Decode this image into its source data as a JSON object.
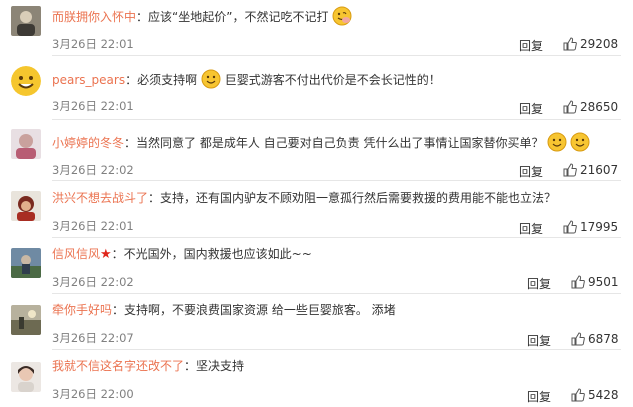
{
  "comments": [
    {
      "username": "而朕拥你入怀中",
      "text": "：应该“坐地起价”，不然记吃不记打",
      "emoji": "face-peek-icon",
      "time": "3月26日 22:01",
      "reply_label": "回复",
      "likes": "29208"
    },
    {
      "username": "pears_pears",
      "text_before": "：必须支持啊",
      "emoji": "smile-face-icon",
      "text_after": "巨婴式游客不付出代价是不会长记性的！",
      "time": "3月26日 22:01",
      "reply_label": "回复",
      "likes": "28650"
    },
    {
      "username": "小婷婷的冬冬",
      "text": "：当然同意了 都是成年人 自己要对自己负责 凭什么出了事情让国家替你买单？",
      "emoji": "double-smile-face-icon",
      "time": "3月26日 22:02",
      "reply_label": "回复",
      "likes": "21607"
    },
    {
      "username": "洪兴不想去战斗了",
      "text": "：支持，还有国内驴友不顾劝阻一意孤行然后需要救援的费用能不能也立法？",
      "time": "3月26日 22:01",
      "reply_label": "回复",
      "likes": "17995"
    },
    {
      "username": "信风信风",
      "badge": "★",
      "text": "：不光国外，国内救援也应该如此~~",
      "time": "3月26日 22:02",
      "reply_label": "回复",
      "likes": "9501"
    },
    {
      "username": "牵你手好吗",
      "text": "：支持啊，不要浪费国家资源 给一些巨婴旅客。 添堵",
      "time": "3月26日 22:07",
      "reply_label": "回复",
      "likes": "6878"
    },
    {
      "username": "我就不信这名字还改不了",
      "text": "：坚决支持",
      "time": "3月26日 22:00",
      "reply_label": "回复",
      "likes": "5428"
    }
  ],
  "colors": {
    "username": "#eb7350",
    "text": "#333333",
    "meta": "#808080",
    "separator": "#e6e6e6",
    "badge": "#e0261b"
  }
}
